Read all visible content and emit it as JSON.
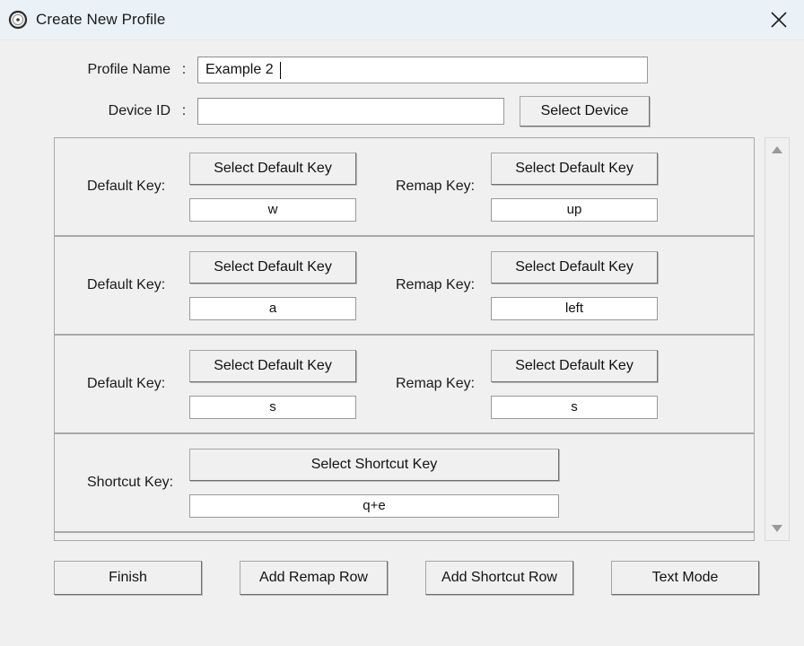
{
  "window": {
    "title": "Create New Profile",
    "title_icon": "target-circle-icon",
    "close_icon": "close-icon"
  },
  "form": {
    "profile_name": {
      "label": "Profile Name",
      "separator": ":",
      "value": "Example 2"
    },
    "device_id": {
      "label": "Device ID",
      "separator": ":",
      "value": "",
      "placeholder": ""
    },
    "select_device_button": "Select Device"
  },
  "rows": [
    {
      "type": "remap",
      "default_label": "Default Key:",
      "default_button": "Select Default Key",
      "default_value": "w",
      "remap_label": "Remap Key:",
      "remap_button": "Select Default Key",
      "remap_value": "up"
    },
    {
      "type": "remap",
      "default_label": "Default Key:",
      "default_button": "Select Default Key",
      "default_value": "a",
      "remap_label": "Remap Key:",
      "remap_button": "Select Default Key",
      "remap_value": "left"
    },
    {
      "type": "remap",
      "default_label": "Default Key:",
      "default_button": "Select Default Key",
      "default_value": "s",
      "remap_label": "Remap Key:",
      "remap_button": "Select Default Key",
      "remap_value": "s"
    },
    {
      "type": "shortcut",
      "shortcut_label": "Shortcut Key:",
      "shortcut_button": "Select Shortcut Key",
      "shortcut_value": "q+e"
    }
  ],
  "scrollbar": {
    "up_icon": "triangle-up-icon",
    "down_icon": "triangle-down-icon"
  },
  "footer": {
    "finish": "Finish",
    "add_remap_row": "Add Remap Row",
    "add_shortcut_row": "Add Shortcut Row",
    "text_mode": "Text Mode"
  },
  "colors": {
    "titlebar": "#eaf2f7",
    "body": "#f0f0f0",
    "border": "#a8a8a8",
    "field": "#ffffff",
    "text": "#1a1a1a"
  }
}
